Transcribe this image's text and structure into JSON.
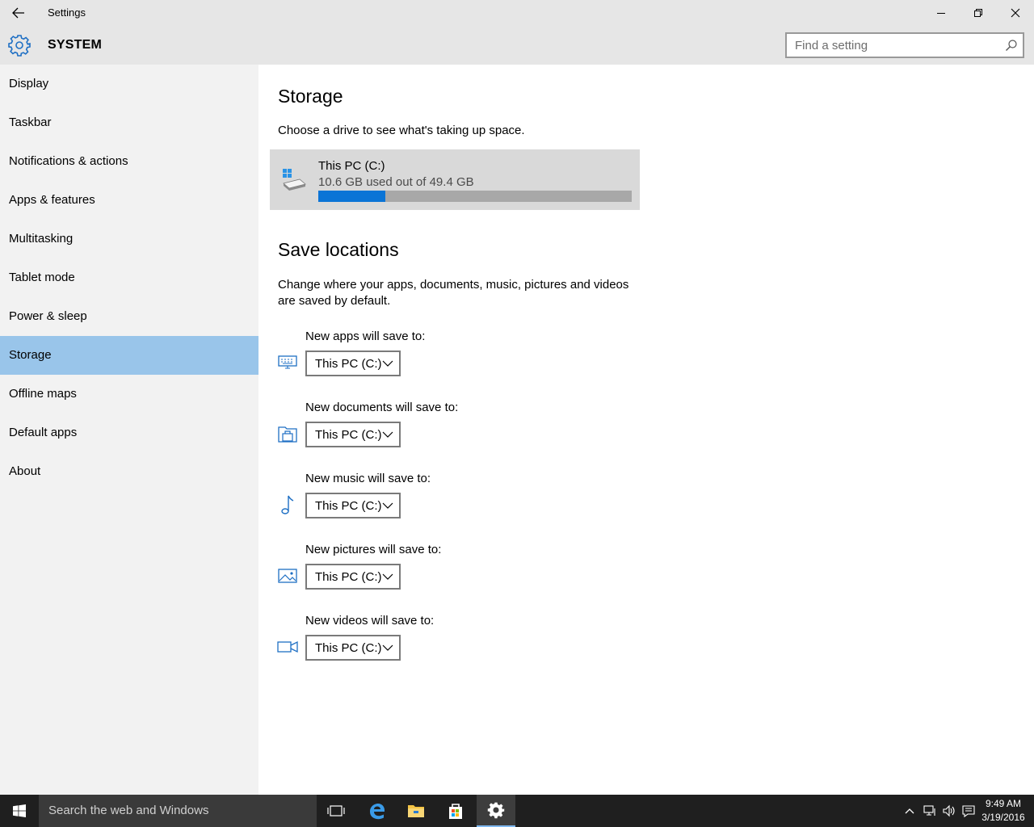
{
  "window": {
    "title": "Settings"
  },
  "header": {
    "section": "SYSTEM",
    "search_placeholder": "Find a setting"
  },
  "sidebar": {
    "items": [
      {
        "label": "Display"
      },
      {
        "label": "Taskbar"
      },
      {
        "label": "Notifications & actions"
      },
      {
        "label": "Apps & features"
      },
      {
        "label": "Multitasking"
      },
      {
        "label": "Tablet mode"
      },
      {
        "label": "Power & sleep"
      },
      {
        "label": "Storage",
        "selected": true
      },
      {
        "label": "Offline maps"
      },
      {
        "label": "Default apps"
      },
      {
        "label": "About"
      }
    ]
  },
  "main": {
    "storage_title": "Storage",
    "storage_desc": "Choose a drive to see what's taking up space.",
    "drive": {
      "name": "This PC (C:)",
      "usage": "10.6 GB used out of 49.4 GB",
      "used_fraction": 0.2146
    },
    "save_title": "Save locations",
    "save_desc": "Change where your apps, documents, music, pictures and videos are saved by default.",
    "locations": [
      {
        "label": "New apps will save to:",
        "value": "This PC (C:)",
        "icon": "monitor-icon"
      },
      {
        "label": "New documents will save to:",
        "value": "This PC (C:)",
        "icon": "documents-icon"
      },
      {
        "label": "New music will save to:",
        "value": "This PC (C:)",
        "icon": "music-note-icon"
      },
      {
        "label": "New pictures will save to:",
        "value": "This PC (C:)",
        "icon": "picture-icon"
      },
      {
        "label": "New videos will save to:",
        "value": "This PC (C:)",
        "icon": "video-camera-icon"
      }
    ]
  },
  "taskbar": {
    "search_placeholder": "Search the web and Windows",
    "time": "9:49 AM",
    "date": "3/19/2016"
  },
  "colors": {
    "accent": "#0a74d6",
    "selected_nav": "#99c5ea",
    "sidebar_bg": "#f2f2f2",
    "titlebar_bg": "#e6e6e6",
    "taskbar_bg": "#1f1f1f"
  }
}
